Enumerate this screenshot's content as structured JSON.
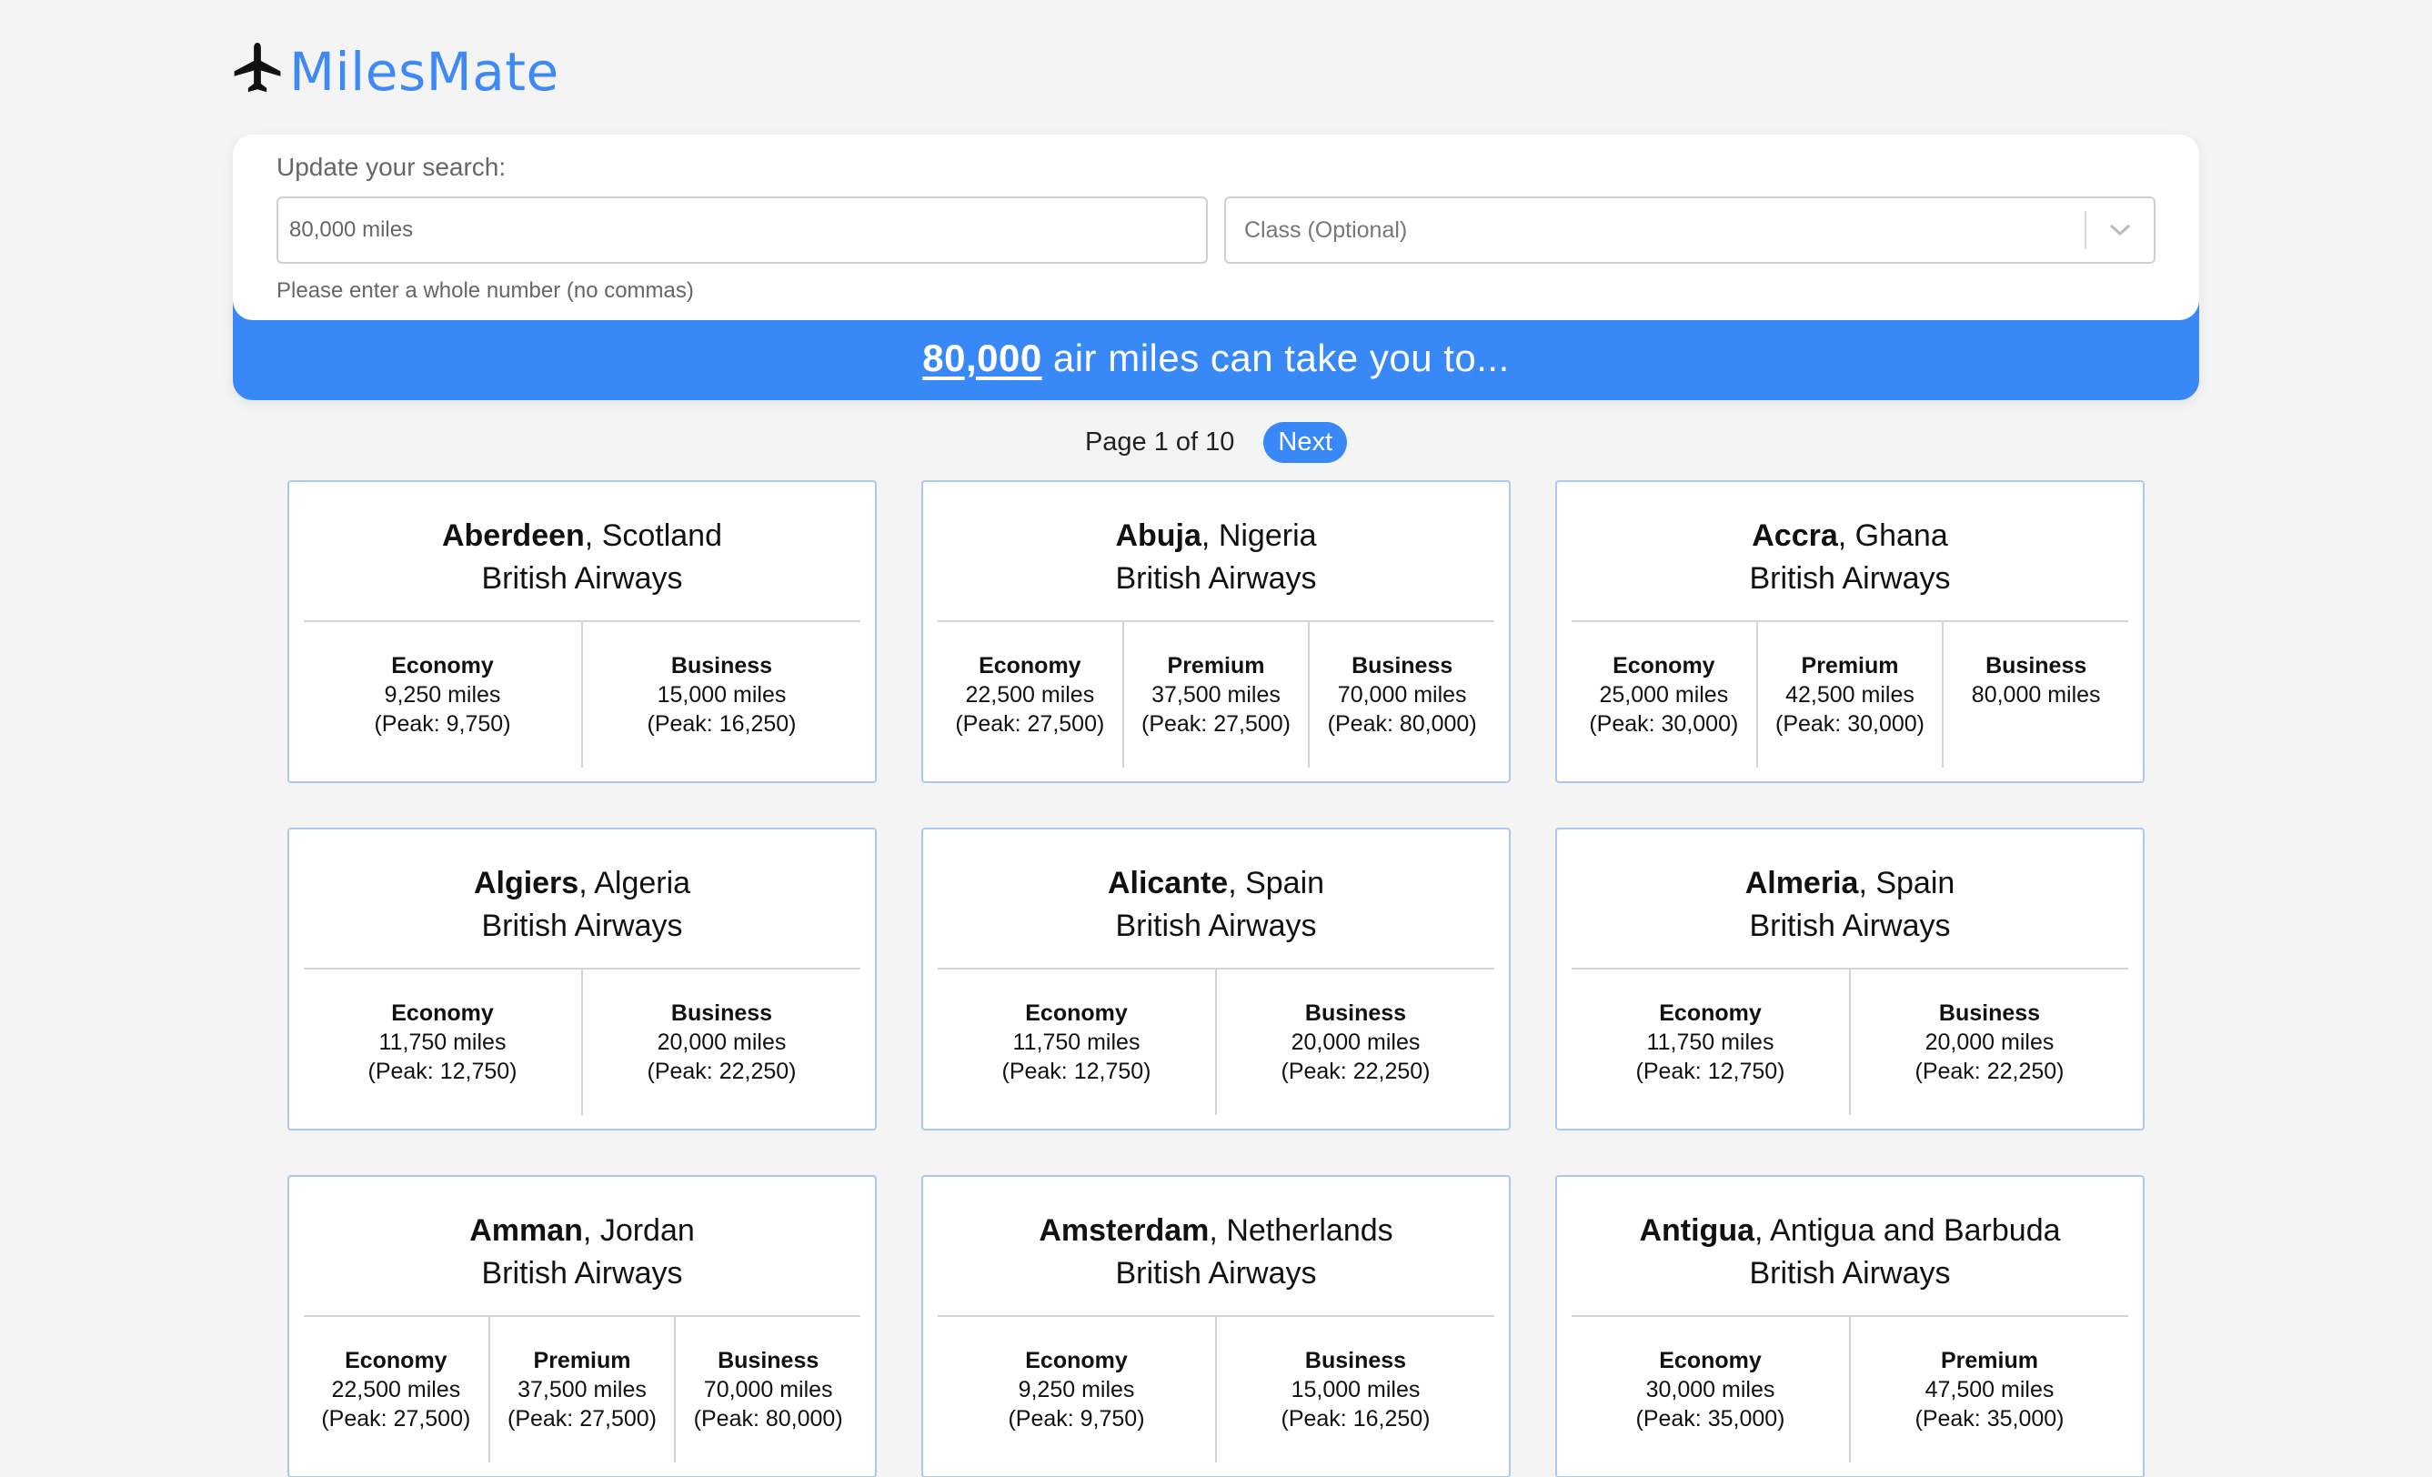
{
  "brand": {
    "name": "MilesMate",
    "logo_icon": "airplane-icon",
    "color": "#3d8af7"
  },
  "search": {
    "label": "Update your search:",
    "miles_placeholder": "80,000 miles",
    "class_placeholder": "Class (Optional)",
    "helper": "Please enter a whole number (no commas)"
  },
  "banner": {
    "amount": "80,000",
    "text": " air miles can take you to...",
    "color": "#3889f7"
  },
  "pagination": {
    "label": "Page 1 of 10",
    "next_label": "Next"
  },
  "destinations": [
    {
      "city": "Aberdeen",
      "country": ", Scotland",
      "airline": "British Airways",
      "fares": [
        {
          "cls": "Economy",
          "miles": "9,250 miles",
          "peak": "(Peak: 9,750)"
        },
        {
          "cls": "Business",
          "miles": "15,000 miles",
          "peak": "(Peak: 16,250)"
        }
      ]
    },
    {
      "city": "Abuja",
      "country": ", Nigeria",
      "airline": "British Airways",
      "fares": [
        {
          "cls": "Economy",
          "miles": "22,500 miles",
          "peak": "(Peak: 27,500)"
        },
        {
          "cls": "Premium",
          "miles": "37,500 miles",
          "peak": "(Peak: 27,500)"
        },
        {
          "cls": "Business",
          "miles": "70,000 miles",
          "peak": "(Peak: 80,000)"
        }
      ]
    },
    {
      "city": "Accra",
      "country": ", Ghana",
      "airline": "British Airways",
      "fares": [
        {
          "cls": "Economy",
          "miles": "25,000 miles",
          "peak": "(Peak: 30,000)"
        },
        {
          "cls": "Premium",
          "miles": "42,500 miles",
          "peak": "(Peak: 30,000)"
        },
        {
          "cls": "Business",
          "miles": "80,000 miles",
          "peak": ""
        }
      ]
    },
    {
      "city": "Algiers",
      "country": ", Algeria",
      "airline": "British Airways",
      "fares": [
        {
          "cls": "Economy",
          "miles": "11,750 miles",
          "peak": "(Peak: 12,750)"
        },
        {
          "cls": "Business",
          "miles": "20,000 miles",
          "peak": "(Peak: 22,250)"
        }
      ]
    },
    {
      "city": "Alicante",
      "country": ", Spain",
      "airline": "British Airways",
      "fares": [
        {
          "cls": "Economy",
          "miles": "11,750 miles",
          "peak": "(Peak: 12,750)"
        },
        {
          "cls": "Business",
          "miles": "20,000 miles",
          "peak": "(Peak: 22,250)"
        }
      ]
    },
    {
      "city": "Almeria",
      "country": ", Spain",
      "airline": "British Airways",
      "fares": [
        {
          "cls": "Economy",
          "miles": "11,750 miles",
          "peak": "(Peak: 12,750)"
        },
        {
          "cls": "Business",
          "miles": "20,000 miles",
          "peak": "(Peak: 22,250)"
        }
      ]
    },
    {
      "city": "Amman",
      "country": ", Jordan",
      "airline": "British Airways",
      "fares": [
        {
          "cls": "Economy",
          "miles": "22,500 miles",
          "peak": "(Peak: 27,500)"
        },
        {
          "cls": "Premium",
          "miles": "37,500 miles",
          "peak": "(Peak: 27,500)"
        },
        {
          "cls": "Business",
          "miles": "70,000 miles",
          "peak": "(Peak: 80,000)"
        }
      ]
    },
    {
      "city": "Amsterdam",
      "country": ", Netherlands",
      "airline": "British Airways",
      "fares": [
        {
          "cls": "Economy",
          "miles": "9,250 miles",
          "peak": "(Peak: 9,750)"
        },
        {
          "cls": "Business",
          "miles": "15,000 miles",
          "peak": "(Peak: 16,250)"
        }
      ]
    },
    {
      "city": "Antigua",
      "country": ", Antigua and Barbuda",
      "airline": "British Airways",
      "fares": [
        {
          "cls": "Economy",
          "miles": "30,000 miles",
          "peak": "(Peak: 35,000)"
        },
        {
          "cls": "Premium",
          "miles": "47,500 miles",
          "peak": "(Peak: 35,000)"
        }
      ]
    }
  ]
}
